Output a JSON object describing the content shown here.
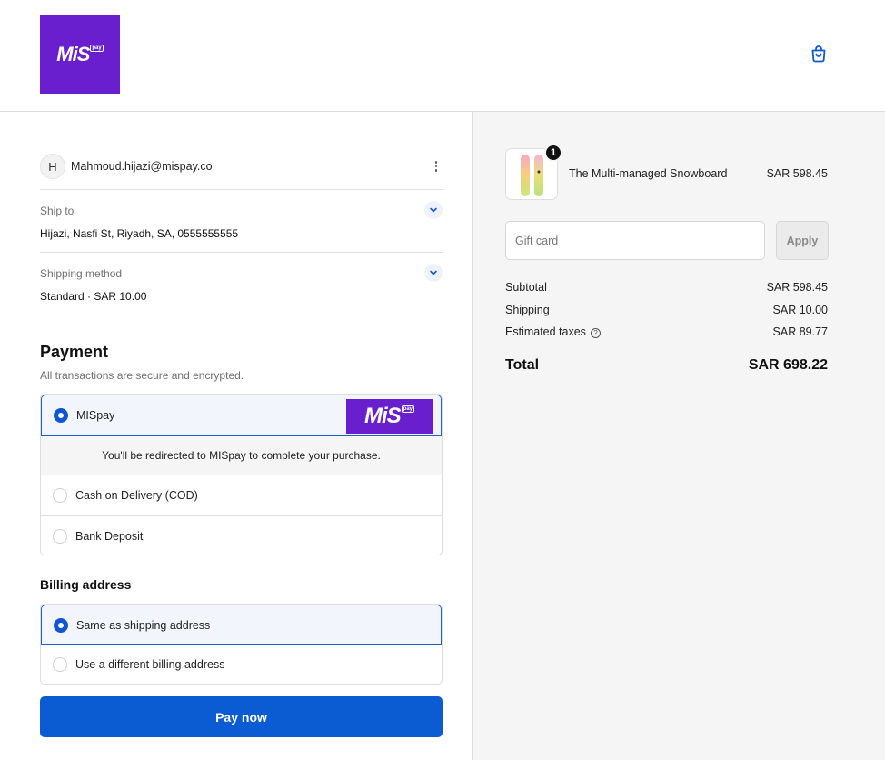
{
  "header": {
    "logo_text": "MiS",
    "logo_badge": "pay",
    "colors": {
      "brand": "#6a1fcf",
      "accent": "#0b5bd2"
    }
  },
  "account": {
    "avatar_initial": "H",
    "email": "Mahmoud.hijazi@mispay.co"
  },
  "ship_to": {
    "label": "Ship to",
    "value": "Hijazi, Nasfi St, Riyadh, SA, 0555555555"
  },
  "shipping_method": {
    "label": "Shipping method",
    "name": "Standard",
    "separator": " · ",
    "price": "SAR 10.00"
  },
  "payment": {
    "title": "Payment",
    "subtitle": "All transactions are secure and encrypted.",
    "options": [
      {
        "label": "MISpay",
        "selected": true
      },
      {
        "label": "Cash on Delivery (COD)",
        "selected": false
      },
      {
        "label": "Bank Deposit",
        "selected": false
      }
    ],
    "redirect_note": "You'll be redirected to MISpay to complete your purchase."
  },
  "billing": {
    "title": "Billing address",
    "options": [
      {
        "label": "Same as shipping address",
        "selected": true
      },
      {
        "label": "Use a different billing address",
        "selected": false
      }
    ]
  },
  "pay_button": "Pay now",
  "order": {
    "product": {
      "name": "The Multi-managed Snowboard",
      "price": "SAR 598.45",
      "quantity": "1"
    },
    "gift_card": {
      "placeholder": "Gift card",
      "apply_label": "Apply"
    },
    "summary": [
      {
        "label": "Subtotal",
        "value": "SAR 598.45"
      },
      {
        "label": "Shipping",
        "value": "SAR 10.00"
      },
      {
        "label": "Estimated taxes",
        "value": "SAR 89.77"
      }
    ],
    "total_label": "Total",
    "total_value": "SAR 698.22"
  }
}
